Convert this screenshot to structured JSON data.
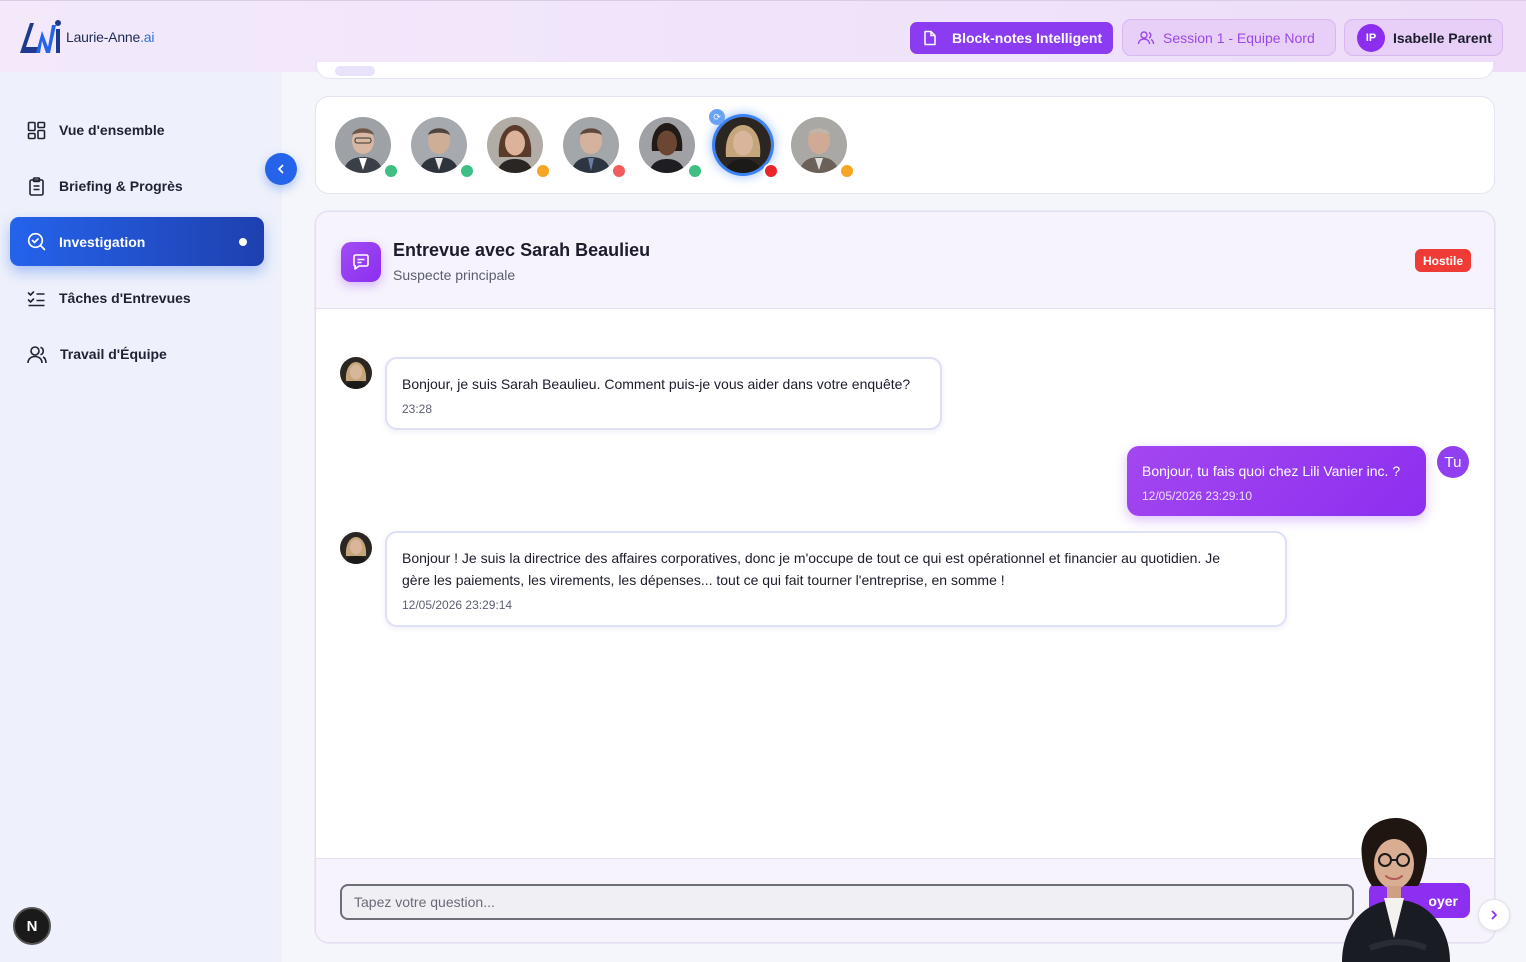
{
  "app": {
    "logo_name": "Laurie-Anne",
    "logo_suffix": ".ai"
  },
  "header": {
    "notes_label": "Block-notes Intelligent",
    "session_label": "Session 1 - Equipe Nord",
    "user_initials": "IP",
    "user_name": "Isabelle Parent"
  },
  "sidebar": {
    "items": [
      {
        "label": "Vue d'ensemble",
        "icon": "grid-icon"
      },
      {
        "label": "Briefing & Progrès",
        "icon": "clipboard-icon"
      },
      {
        "label": "Investigation",
        "icon": "search-check-icon",
        "active": true
      },
      {
        "label": "Tâches d'Entrevues",
        "icon": "checklist-icon"
      },
      {
        "label": "Travail d'Équipe",
        "icon": "users-icon"
      }
    ],
    "badge": "N"
  },
  "suspects": [
    {
      "status_color": "#3fbf84"
    },
    {
      "status_color": "#3fbf84"
    },
    {
      "status_color": "#f5a623"
    },
    {
      "status_color": "#f25c5c"
    },
    {
      "status_color": "#3fbf84"
    },
    {
      "status_color": "#e8262b",
      "selected": true
    },
    {
      "status_color": "#f5a623"
    }
  ],
  "chat": {
    "title": "Entrevue avec Sarah Beaulieu",
    "subtitle": "Suspecte principale",
    "badge": "Hostile",
    "user_avatar": "Tu",
    "messages": [
      {
        "from": "suspect",
        "text": "Bonjour, je suis Sarah Beaulieu. Comment puis-je vous aider dans votre enquête?",
        "time": "23:28"
      },
      {
        "from": "user",
        "text": "Bonjour, tu fais quoi chez Lili Vanier inc. ?",
        "time": "12/05/2026 23:29:10"
      },
      {
        "from": "suspect",
        "text_line1": "Bonjour ! Je suis la directrice des affaires corporatives, donc je m'occupe de tout ce qui est opérationnel et financier au quotidien. Je",
        "text_line2": "gère les paiements, les virements, les dépenses... tout ce qui fait tourner l'entreprise, en somme !",
        "time": "12/05/2026 23:29:14"
      }
    ],
    "input_placeholder": "Tapez votre question...",
    "send_label": "Envoyer",
    "send_label_visible": "oyer"
  },
  "colors": {
    "accent_purple": "#8c2ff0",
    "accent_blue": "#2563eb",
    "hostile_red": "#ef3b36"
  }
}
